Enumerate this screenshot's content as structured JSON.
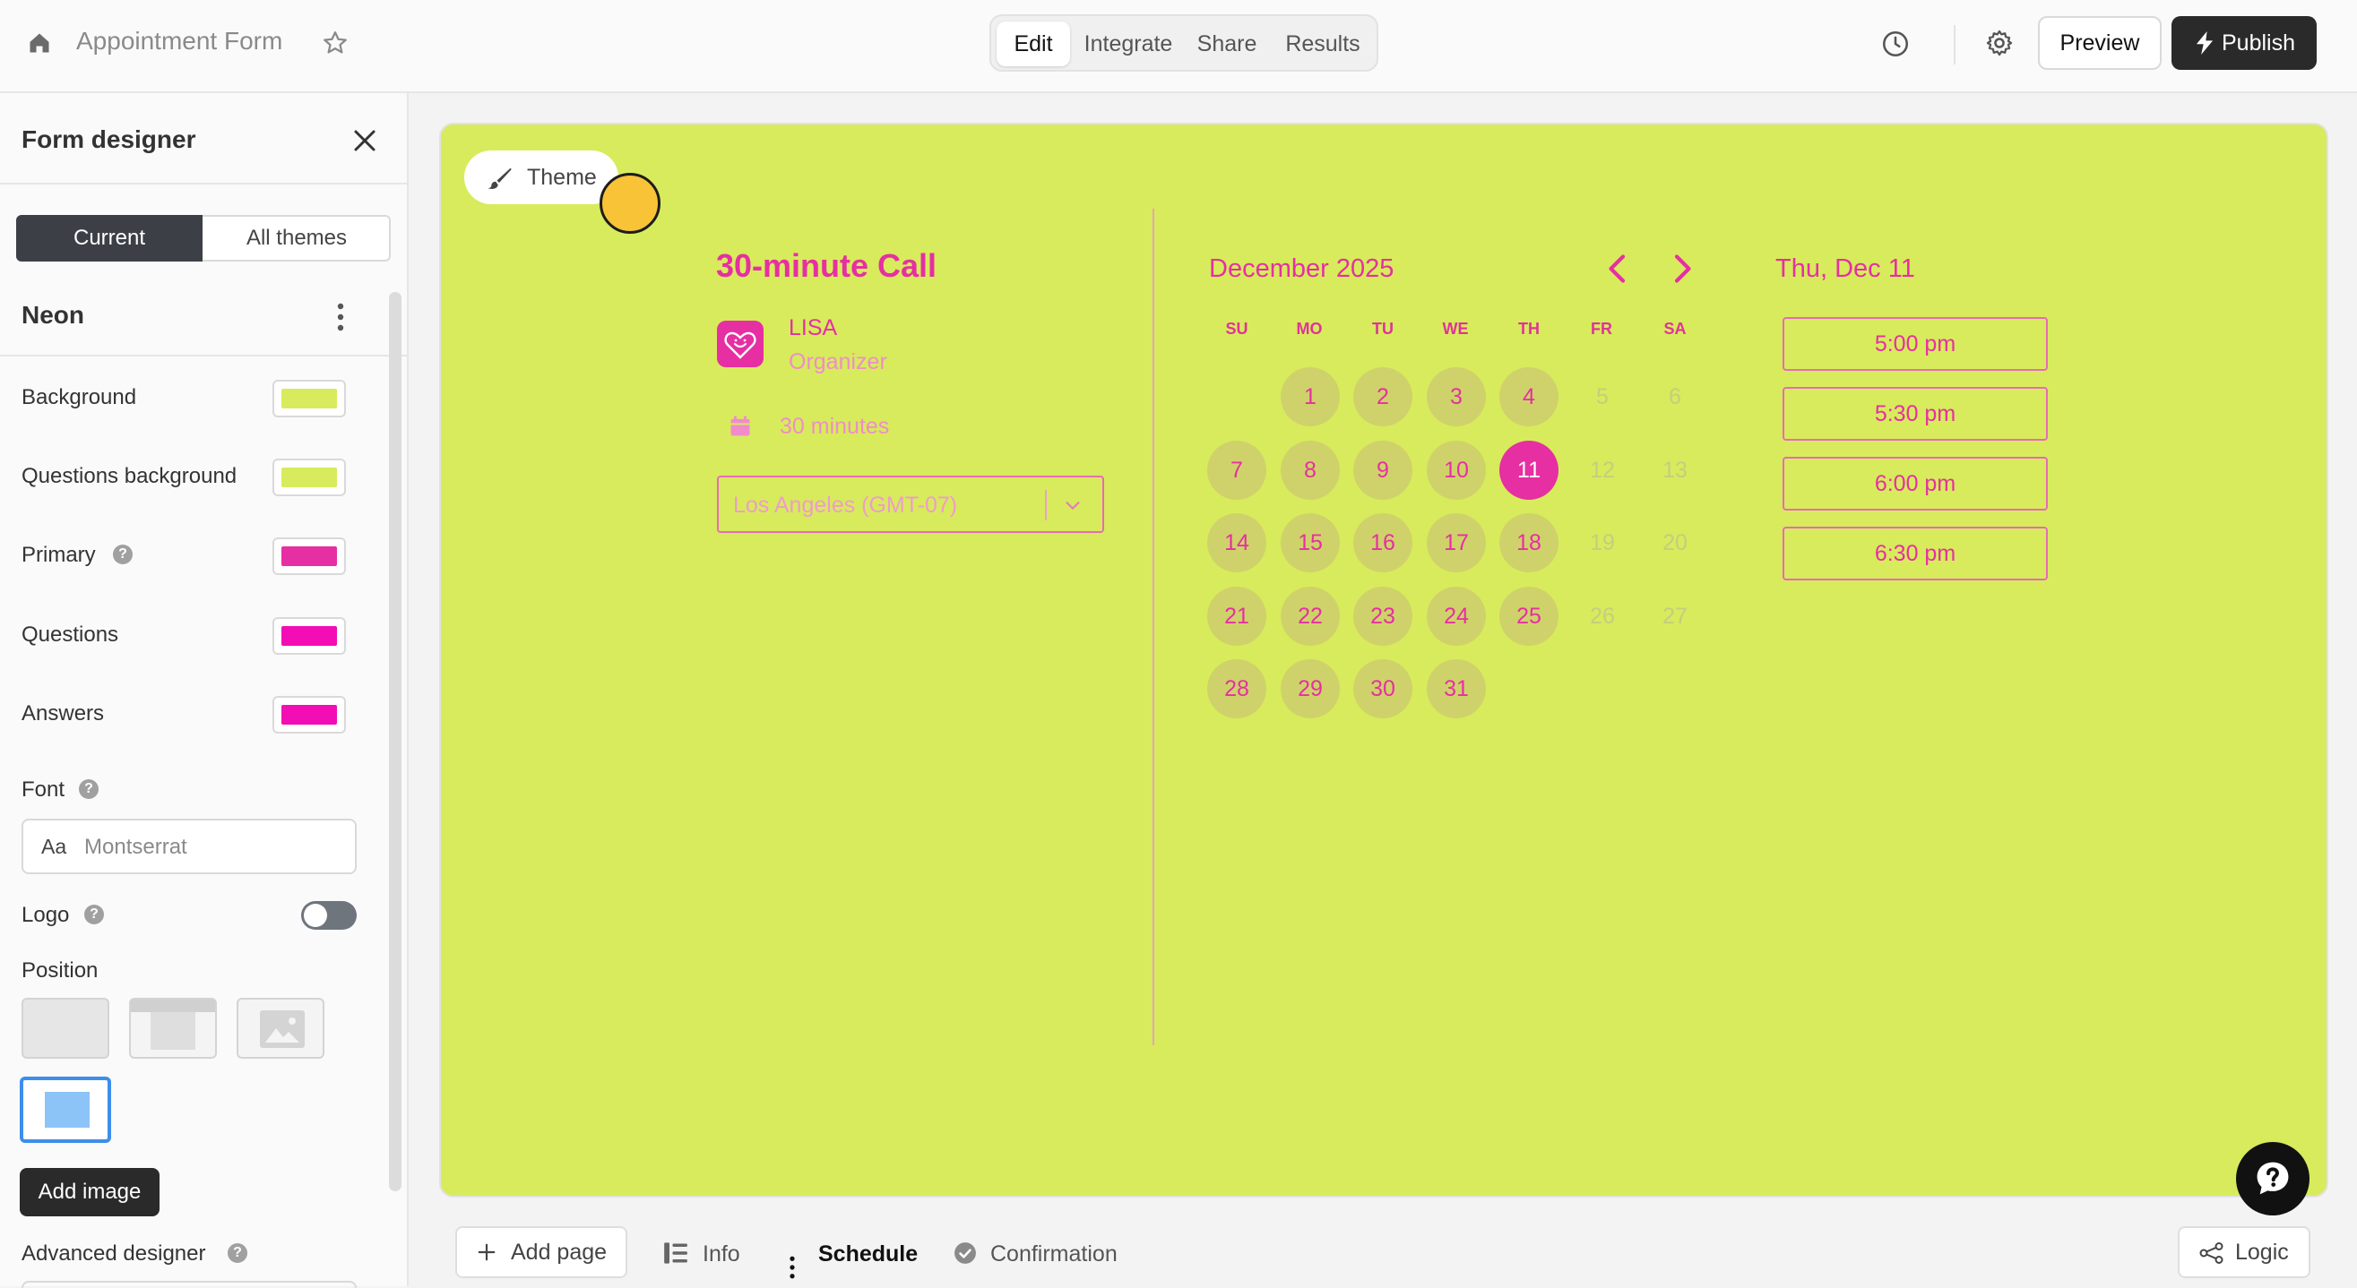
{
  "header": {
    "form_title": "Appointment Form",
    "tabs": [
      {
        "label": "Edit",
        "active": true
      },
      {
        "label": "Integrate",
        "active": false
      },
      {
        "label": "Share",
        "active": false
      },
      {
        "label": "Results",
        "active": false
      }
    ],
    "preview_label": "Preview",
    "publish_label": "Publish",
    "icons": [
      "home-icon",
      "star-icon",
      "history-icon",
      "gear-icon",
      "lightning-icon"
    ]
  },
  "sidebar": {
    "title": "Form designer",
    "theme_tabs": [
      {
        "label": "Current",
        "active": true
      },
      {
        "label": "All themes",
        "active": false
      }
    ],
    "theme_name": "Neon",
    "colors": [
      {
        "label": "Background",
        "color": "#d8eb5c"
      },
      {
        "label": "Questions background",
        "color": "#d8eb5c"
      },
      {
        "label": "Primary",
        "color": "#e62fa3"
      },
      {
        "label": "Questions",
        "color": "#f20db5"
      },
      {
        "label": "Answers",
        "color": "#f20db5"
      }
    ],
    "font_label": "Font",
    "font_prefix": "Aa",
    "font_value": "Montserrat",
    "logo_label": "Logo",
    "logo_enabled": false,
    "position_label": "Position",
    "add_image_label": "Add image",
    "advanced_label": "Advanced designer"
  },
  "canvas": {
    "theme_button_label": "Theme",
    "call_title": "30-minute Call",
    "organizer_name": "LISA",
    "organizer_role": "Organizer",
    "duration": "30 minutes",
    "timezone": "Los Angeles (GMT-07)",
    "month_title": "December 2025",
    "weekdays": [
      "SU",
      "MO",
      "TU",
      "WE",
      "TH",
      "FR",
      "SA"
    ],
    "selected_date_title": "Thu, Dec 11",
    "selected_day": 11,
    "time_slots": [
      "5:00 pm",
      "5:30 pm",
      "6:00 pm",
      "6:30 pm"
    ],
    "background_color": "#d8eb5c",
    "primary_color": "#e62fa3"
  },
  "calendar_days": [
    {
      "day": "1",
      "status": "available"
    },
    {
      "day": "2",
      "status": "available"
    },
    {
      "day": "3",
      "status": "available"
    },
    {
      "day": "4",
      "status": "available"
    },
    {
      "day": "5",
      "status": "unavailable"
    },
    {
      "day": "6",
      "status": "unavailable"
    },
    {
      "day": "7",
      "status": "available"
    },
    {
      "day": "8",
      "status": "available"
    },
    {
      "day": "9",
      "status": "available"
    },
    {
      "day": "10",
      "status": "available"
    },
    {
      "day": "11",
      "status": "selected"
    },
    {
      "day": "12",
      "status": "unavailable"
    },
    {
      "day": "13",
      "status": "unavailable"
    },
    {
      "day": "14",
      "status": "available"
    },
    {
      "day": "15",
      "status": "available"
    },
    {
      "day": "16",
      "status": "available"
    },
    {
      "day": "17",
      "status": "available"
    },
    {
      "day": "18",
      "status": "available"
    },
    {
      "day": "19",
      "status": "unavailable"
    },
    {
      "day": "20",
      "status": "unavailable"
    },
    {
      "day": "21",
      "status": "available"
    },
    {
      "day": "22",
      "status": "available"
    },
    {
      "day": "23",
      "status": "available"
    },
    {
      "day": "24",
      "status": "available"
    },
    {
      "day": "25",
      "status": "available"
    },
    {
      "day": "26",
      "status": "unavailable"
    },
    {
      "day": "27",
      "status": "unavailable"
    },
    {
      "day": "28",
      "status": "available"
    },
    {
      "day": "29",
      "status": "available"
    },
    {
      "day": "30",
      "status": "available"
    },
    {
      "day": "31",
      "status": "available"
    }
  ],
  "footer": {
    "add_page_label": "Add page",
    "pages": [
      {
        "label": "Info",
        "active": false
      },
      {
        "label": "Schedule",
        "active": true
      },
      {
        "label": "Confirmation",
        "active": false
      }
    ],
    "logic_label": "Logic"
  }
}
